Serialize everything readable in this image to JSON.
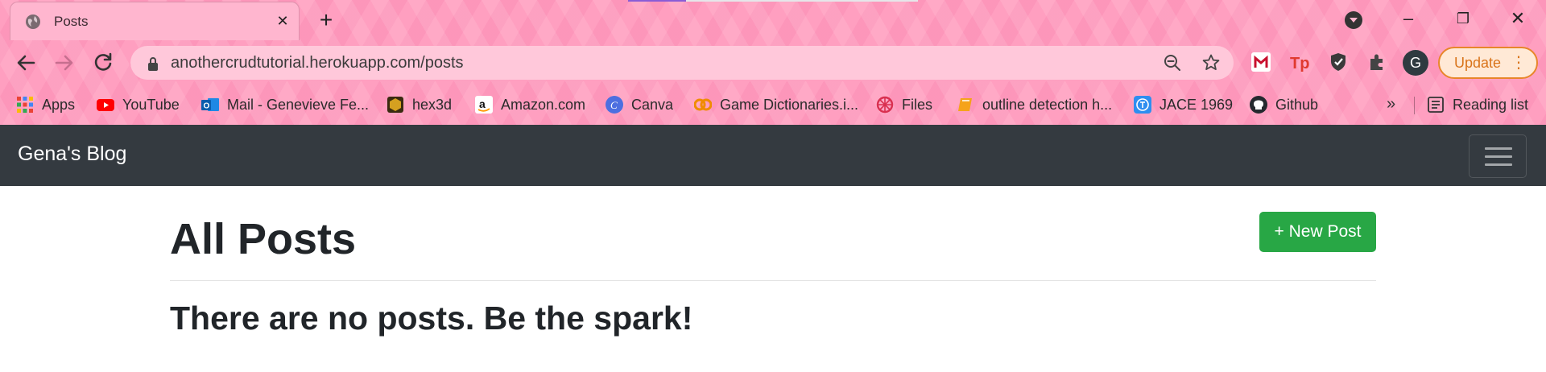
{
  "browser": {
    "tab": {
      "title": "Posts"
    },
    "address_bar": {
      "url": "anothercrudtutorial.herokuapp.com/posts"
    },
    "profile_initial": "G",
    "update_button": {
      "label": "Update"
    },
    "colors": {
      "theme_pink": "#ff9fc0",
      "update_orange": "#e8862a"
    },
    "bookmarks": [
      {
        "label": "Apps",
        "icon": "apps-grid-icon"
      },
      {
        "label": "YouTube",
        "icon": "youtube-icon"
      },
      {
        "label": "Mail - Genevieve Fe...",
        "icon": "outlook-mail-icon"
      },
      {
        "label": "hex3d",
        "icon": "hex3d-icon"
      },
      {
        "label": "Amazon.com",
        "icon": "amazon-icon"
      },
      {
        "label": "Canva",
        "icon": "canva-icon"
      },
      {
        "label": "Game Dictionaries.i...",
        "icon": "game-dictionaries-icon"
      },
      {
        "label": "Files",
        "icon": "files-icon"
      },
      {
        "label": "outline detection h...",
        "icon": "bookmark-book-icon"
      },
      {
        "label": "JACE 1969",
        "icon": "jace-icon"
      },
      {
        "label": "Github",
        "icon": "github-icon"
      }
    ],
    "reading_list": {
      "label": "Reading list"
    },
    "more_bookmarks": "»"
  },
  "site": {
    "brand": "Gena's Blog",
    "navbar_color": "#343a40",
    "page_title": "All Posts",
    "new_post_button": {
      "label": "+ New Post",
      "color": "#28a745"
    },
    "empty_message": "There are no posts. Be the spark!"
  }
}
